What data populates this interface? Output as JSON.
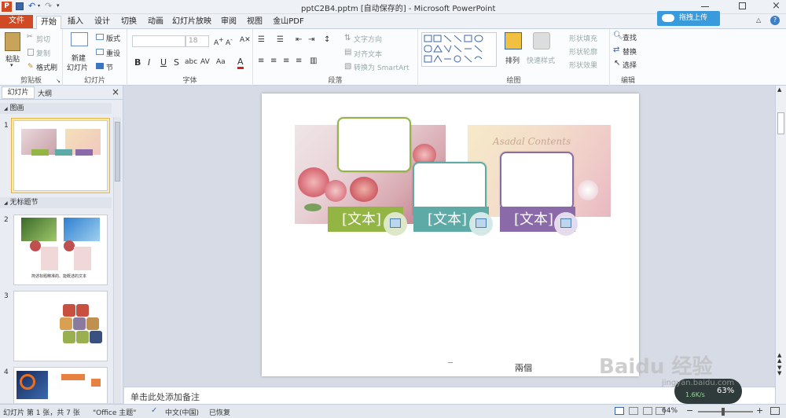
{
  "titlebar": {
    "title": "pptC2B4.pptm [自动保存的] - Microsoft PowerPoint",
    "app_icon_letter": "P",
    "upload_button": "拖拽上传"
  },
  "tabs": [
    "文件",
    "开始",
    "插入",
    "设计",
    "切换",
    "动画",
    "幻灯片放映",
    "审阅",
    "视图",
    "金山PDF"
  ],
  "ribbon": {
    "clipboard": {
      "paste": "粘贴",
      "cut": "剪切",
      "copy": "复制",
      "format_painter": "格式刷",
      "label": "剪贴板"
    },
    "slides": {
      "new_slide": "新建",
      "new_slide2": "幻灯片",
      "layout": "版式",
      "reset": "重设",
      "section": "节",
      "label": "幻灯片"
    },
    "font": {
      "size": "18",
      "label": "字体",
      "bold": "B",
      "italic": "I",
      "underline": "U",
      "strike": "S",
      "shadow": "abc",
      "spacing": "AV",
      "case": "Aa",
      "color": "A"
    },
    "paragraph": {
      "text_direction": "文字方向",
      "align_text": "对齐文本",
      "smartart": "转换为 SmartArt",
      "label": "段落"
    },
    "drawing": {
      "arrange": "排列",
      "quick_styles": "快速样式",
      "shape_fill": "形状填充",
      "shape_outline": "形状轮廓",
      "shape_effects": "形状效果",
      "label": "绘图"
    },
    "editing": {
      "find": "查找",
      "replace": "替换",
      "select": "选择",
      "label": "编辑"
    }
  },
  "leftpane": {
    "tab_slides": "幻灯片",
    "tab_outline": "大纲",
    "section1": "图画",
    "section2": "无标题节",
    "slide_numbers": [
      "1",
      "2",
      "3",
      "4"
    ],
    "thumb2_text": "简述标题精准的、能概述的文本"
  },
  "slide": {
    "card_label": "[文本]",
    "footer_text": "兩個",
    "watermark_text": "Asadal Contents"
  },
  "colors": {
    "green": "#93b544",
    "teal": "#5eaaa6",
    "purple": "#8a6aa8",
    "accent": "#d04a24"
  },
  "notes": {
    "placeholder": "单击此处添加备注"
  },
  "status": {
    "slide_info": "幻灯片 第 1 张，共 7 张",
    "theme": "\"Office 主题\"",
    "language": "中文(中国)",
    "recovered": "已恢复",
    "zoom": "64%",
    "net_speed": "1.6K/s",
    "net_pct": "63%"
  },
  "watermark": {
    "brand": "Baidu 经验",
    "site": "jingyan.baidu.com"
  }
}
